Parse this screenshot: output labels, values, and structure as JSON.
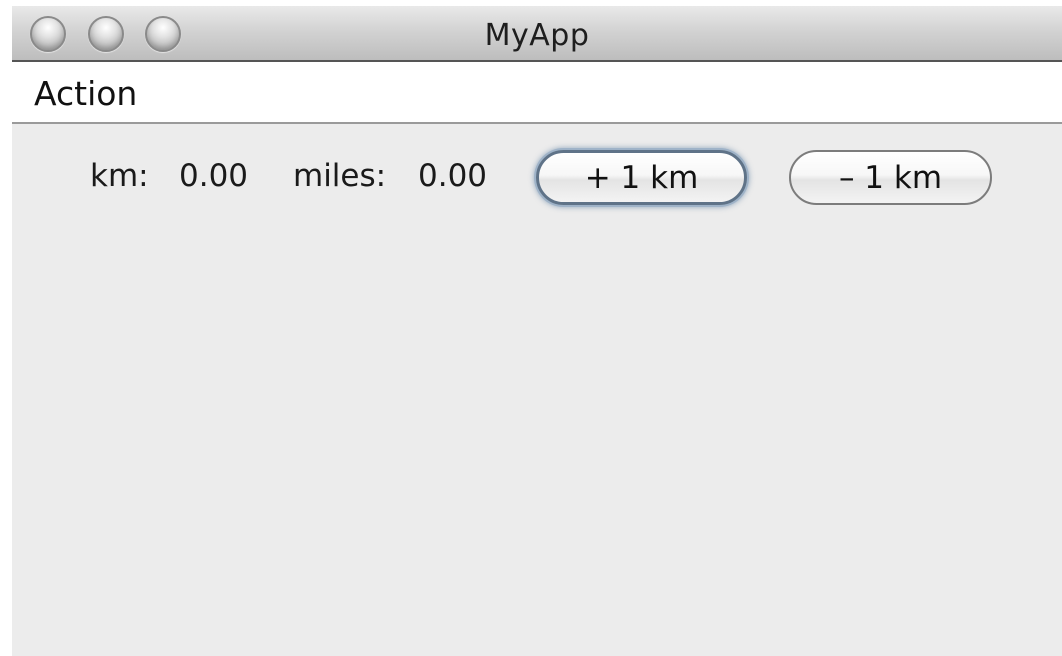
{
  "window": {
    "title": "MyApp"
  },
  "menu": {
    "items": [
      {
        "label": "Action"
      }
    ]
  },
  "converter": {
    "km_label": "km:",
    "km_value": "0.00",
    "miles_label": "miles:",
    "miles_value": "0.00",
    "add_button_label": "+ 1 km",
    "subtract_button_label": "– 1 km"
  }
}
